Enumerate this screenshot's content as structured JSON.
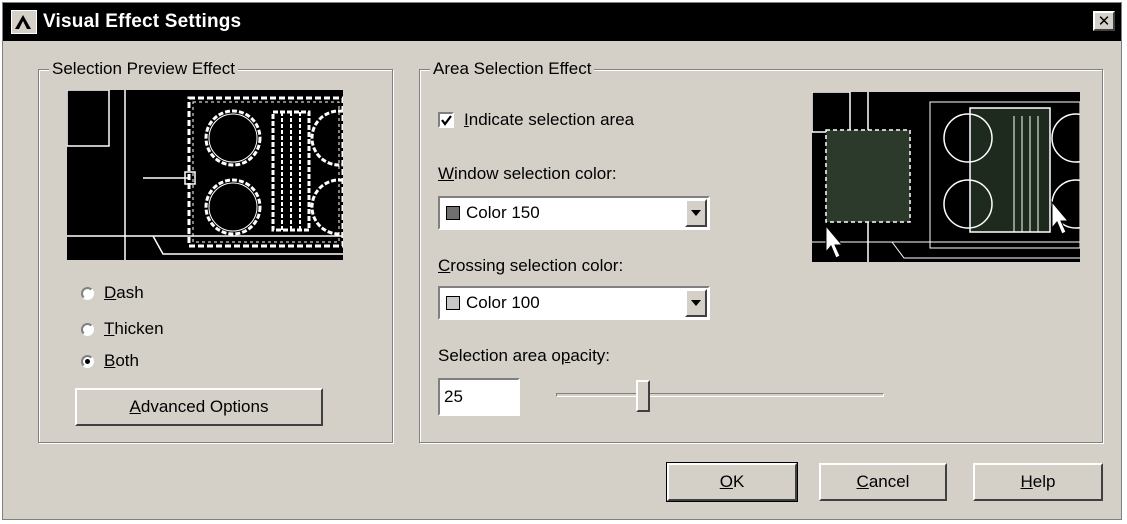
{
  "window": {
    "title": "Visual Effect Settings",
    "close_glyph": "✕"
  },
  "selection_preview": {
    "group_label": "Selection Preview Effect",
    "options": [
      {
        "mnemonic": "D",
        "rest": "ash",
        "checked": false
      },
      {
        "mnemonic": "T",
        "rest": "hicken",
        "checked": false
      },
      {
        "mnemonic": "B",
        "rest": "oth",
        "checked": true
      }
    ],
    "advanced_button": {
      "mnemonic": "A",
      "rest": "dvanced Options"
    }
  },
  "area_selection": {
    "group_label": "Area Selection Effect",
    "indicate_checkbox": {
      "mnemonic": "I",
      "rest": "ndicate selection area",
      "checked": true
    },
    "window_color": {
      "label_mnemonic": "W",
      "label_rest": "indow selection color:",
      "value": "Color 150",
      "swatch": "#707070"
    },
    "crossing_color": {
      "label_mnemonic": "C",
      "label_rest": "rossing selection color:",
      "value": "Color 100",
      "swatch": "#c8c8c8"
    },
    "opacity": {
      "label_pre": "Selection area o",
      "label_mnemonic": "p",
      "label_rest": "acity:",
      "value": "25",
      "slider_fraction": 0.25
    }
  },
  "buttons": {
    "ok": {
      "mnemonic": "O",
      "rest": "K"
    },
    "cancel": {
      "mnemonic": "C",
      "rest": "ancel"
    },
    "help": {
      "mnemonic": "H",
      "rest": "elp"
    }
  },
  "colors": {
    "dialog_bg": "#d4d0c8",
    "titlebar_bg": "#000000",
    "preview_bg": "#000000"
  }
}
